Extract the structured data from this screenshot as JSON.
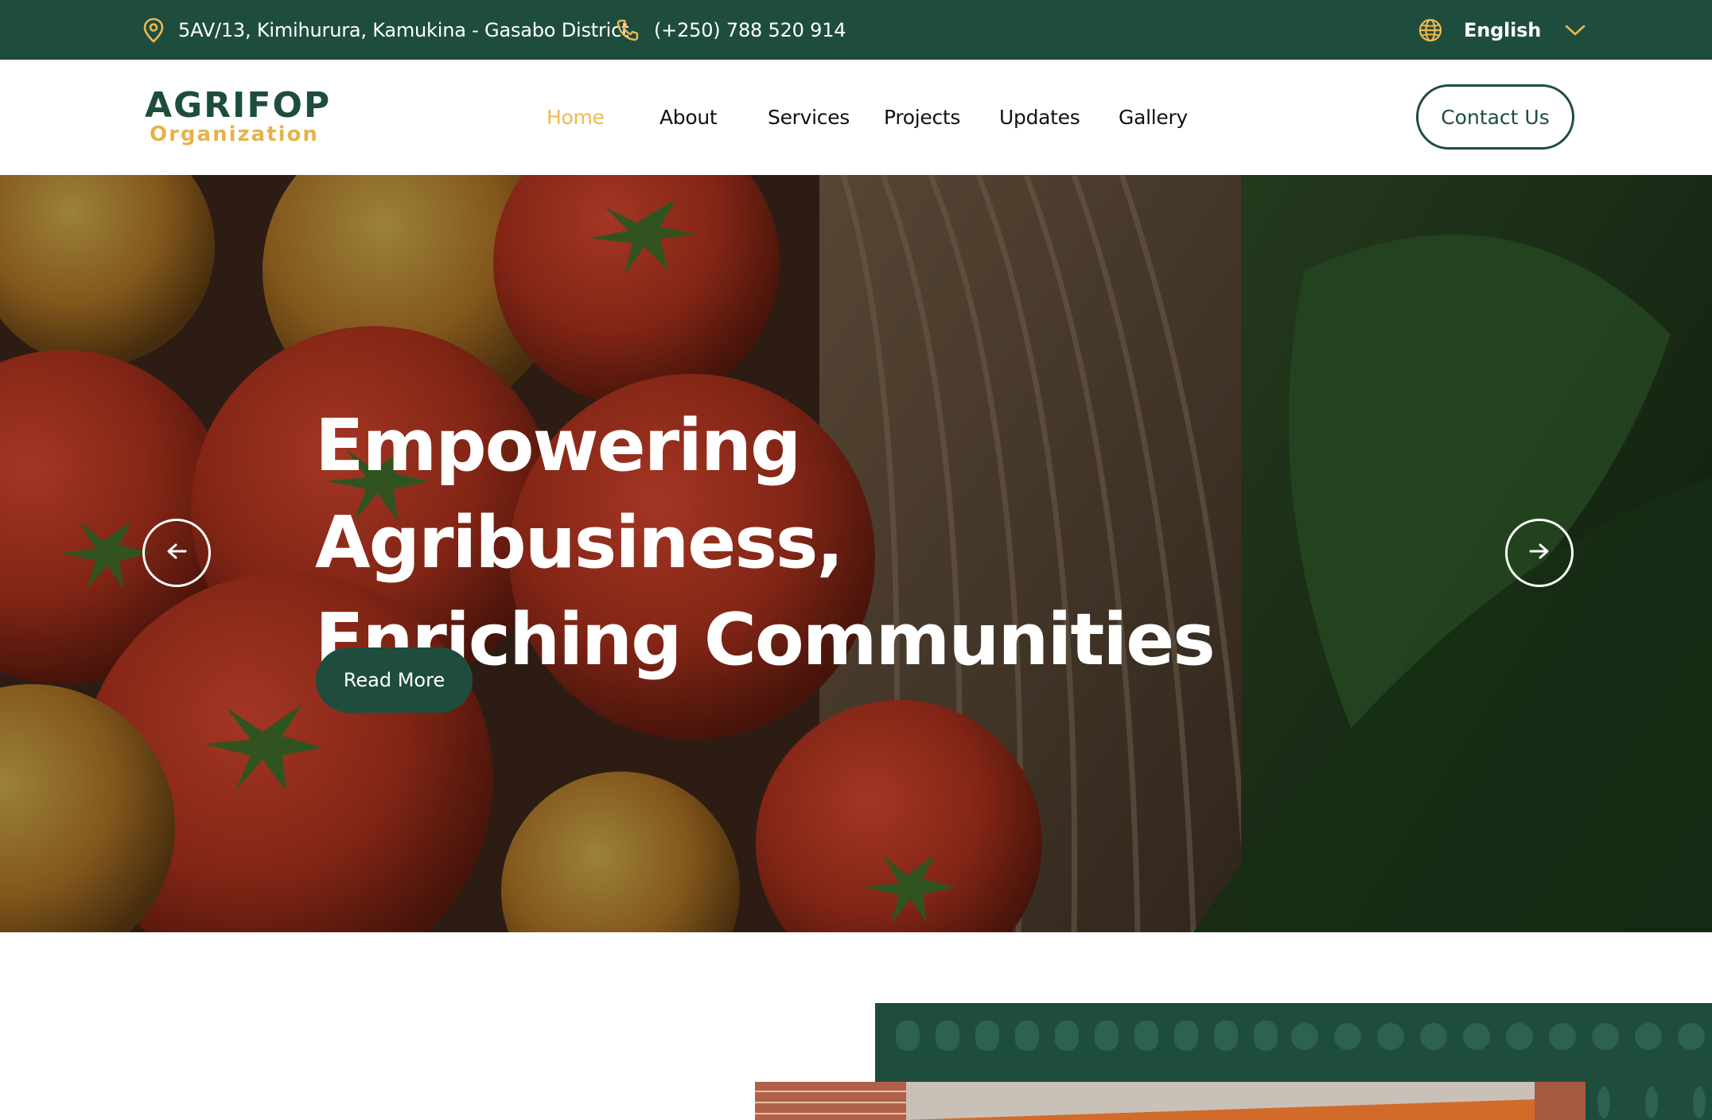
{
  "topbar": {
    "address": "5AV/13, Kimihurura, Kamukina - Gasabo District",
    "phone": "(+250) 788 520 914",
    "language": "English",
    "icons": {
      "location": "map-pin-icon",
      "phone": "phone-icon",
      "globe": "globe-icon",
      "chevron": "chevron-down-icon"
    }
  },
  "brand": {
    "name": "AGRIFOP",
    "subtitle": "Organization"
  },
  "nav": {
    "items": [
      {
        "label": "Home",
        "active": true
      },
      {
        "label": "About",
        "active": false
      },
      {
        "label": "Services",
        "active": false
      },
      {
        "label": "Projects",
        "active": false
      },
      {
        "label": "Updates",
        "active": false
      },
      {
        "label": "Gallery",
        "active": false
      }
    ],
    "contact_label": "Contact Us"
  },
  "hero": {
    "title_line1": "Empowering Agribusiness,",
    "title_line2": "Enriching Communities",
    "cta_label": "Read More",
    "prev_icon": "arrow-left-icon",
    "next_icon": "arrow-right-icon"
  },
  "colors": {
    "brand_green": "#1f4d3d",
    "accent_gold": "#f0b84e"
  }
}
